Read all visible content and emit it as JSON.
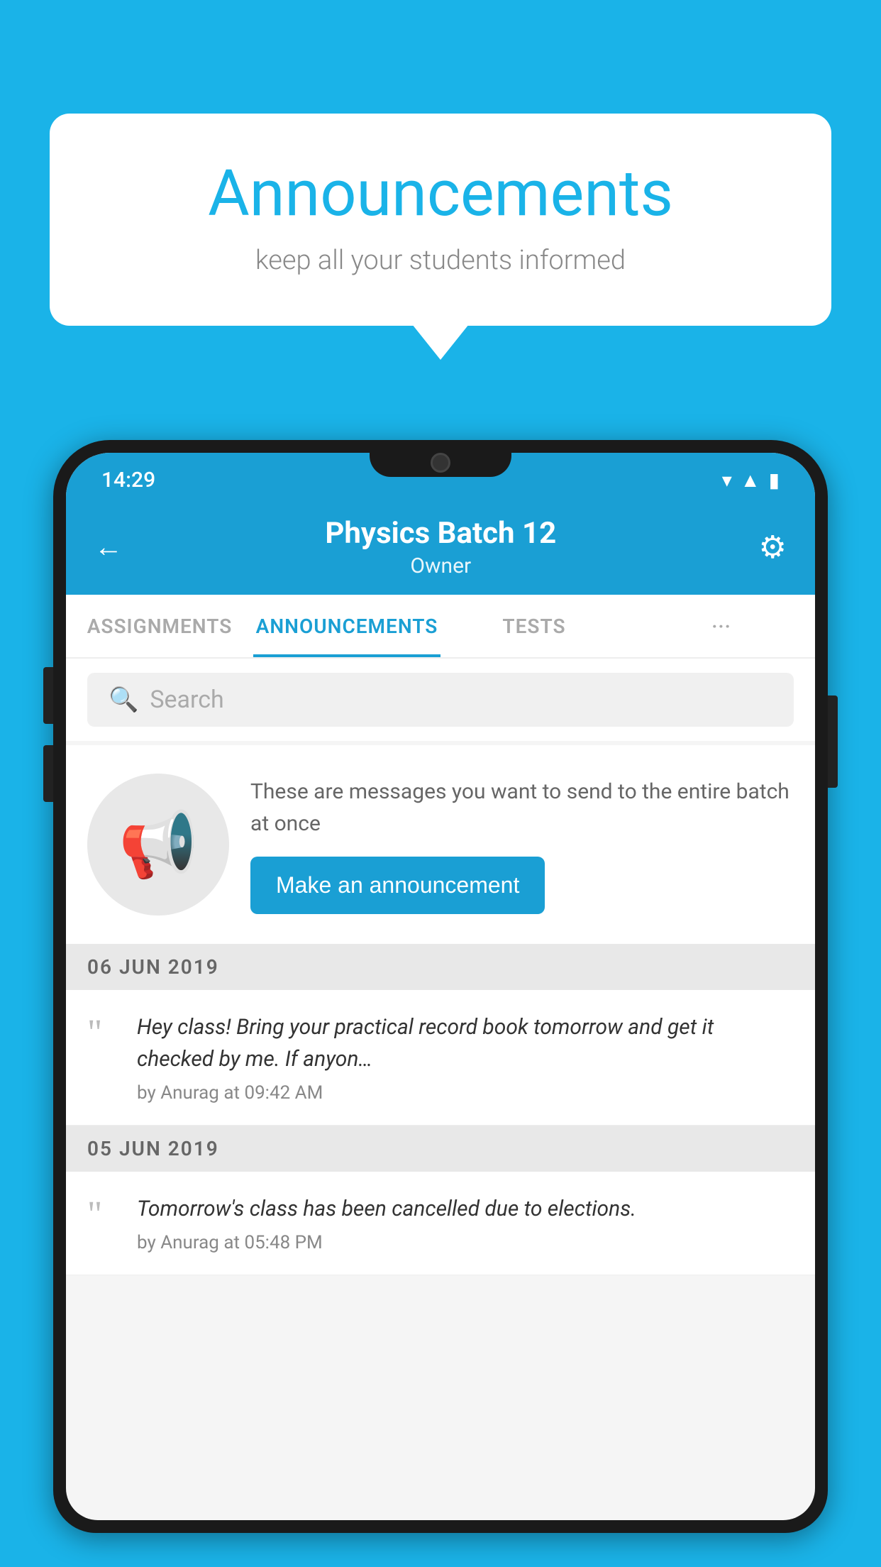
{
  "background_color": "#1ab3e8",
  "speech_bubble": {
    "title": "Announcements",
    "subtitle": "keep all your students informed"
  },
  "status_bar": {
    "time": "14:29",
    "icons": [
      "wifi",
      "signal",
      "battery"
    ]
  },
  "header": {
    "title": "Physics Batch 12",
    "subtitle": "Owner",
    "back_label": "←",
    "gear_label": "⚙"
  },
  "tabs": [
    {
      "label": "ASSIGNMENTS",
      "active": false
    },
    {
      "label": "ANNOUNCEMENTS",
      "active": true
    },
    {
      "label": "TESTS",
      "active": false
    },
    {
      "label": "···",
      "active": false
    }
  ],
  "search": {
    "placeholder": "Search"
  },
  "announcement_prompt": {
    "description_text": "These are messages you want to send to the entire batch at once",
    "button_label": "Make an announcement"
  },
  "announcements": [
    {
      "date": "06  JUN  2019",
      "text": "Hey class! Bring your practical record book tomorrow and get it checked by me. If anyon…",
      "author": "by Anurag at 09:42 AM"
    },
    {
      "date": "05  JUN  2019",
      "text": "Tomorrow's class has been cancelled due to elections.",
      "author": "by Anurag at 05:48 PM"
    }
  ]
}
